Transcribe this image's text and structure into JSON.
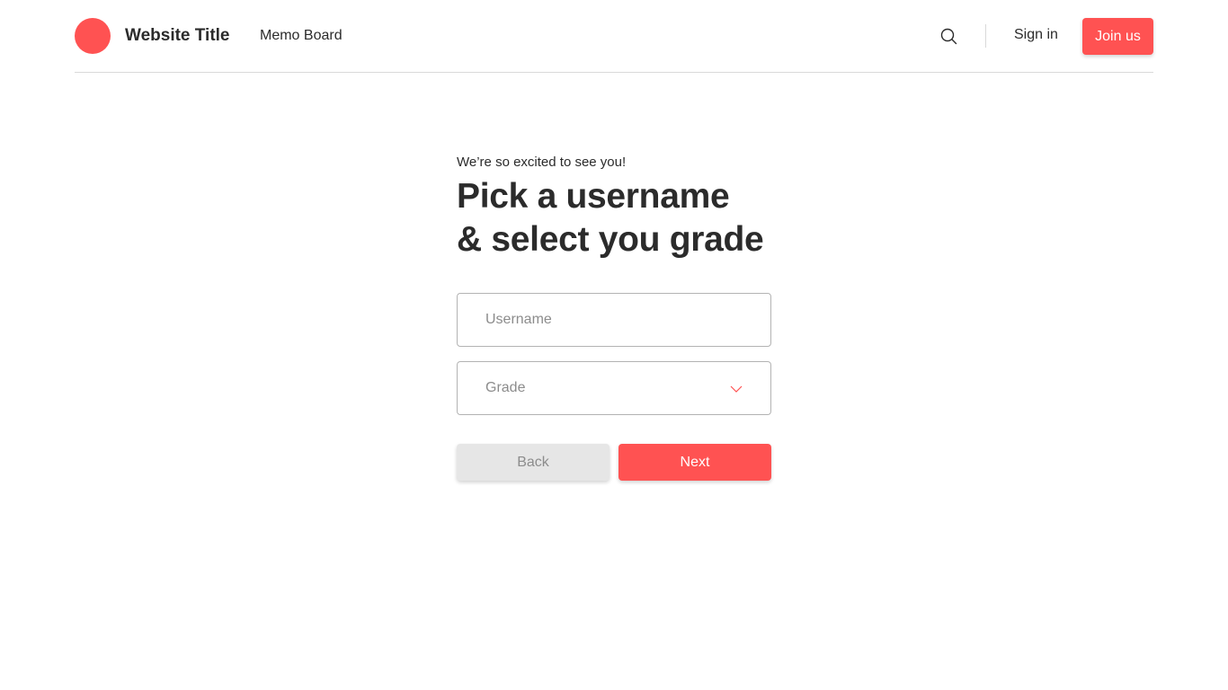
{
  "header": {
    "site_title": "Website Title",
    "nav_link": "Memo Board",
    "signin_label": "Sign in",
    "join_label": "Join us"
  },
  "form": {
    "subtitle": "We’re so excited to see you!",
    "heading_line1": "Pick a username",
    "heading_line2": "& select you grade",
    "username_placeholder": "Username",
    "username_value": "",
    "grade_value": "Grade",
    "back_label": "Back",
    "next_label": "Next"
  },
  "icons": {
    "search": "search-icon",
    "grade_dropdown": "chevron-down-icon"
  },
  "colors": {
    "accent": "#ff5252",
    "text": "#2b2b2b",
    "muted": "#8c8c8c",
    "border": "#b3b3b3",
    "secondary_button": "#e6e6e6"
  }
}
